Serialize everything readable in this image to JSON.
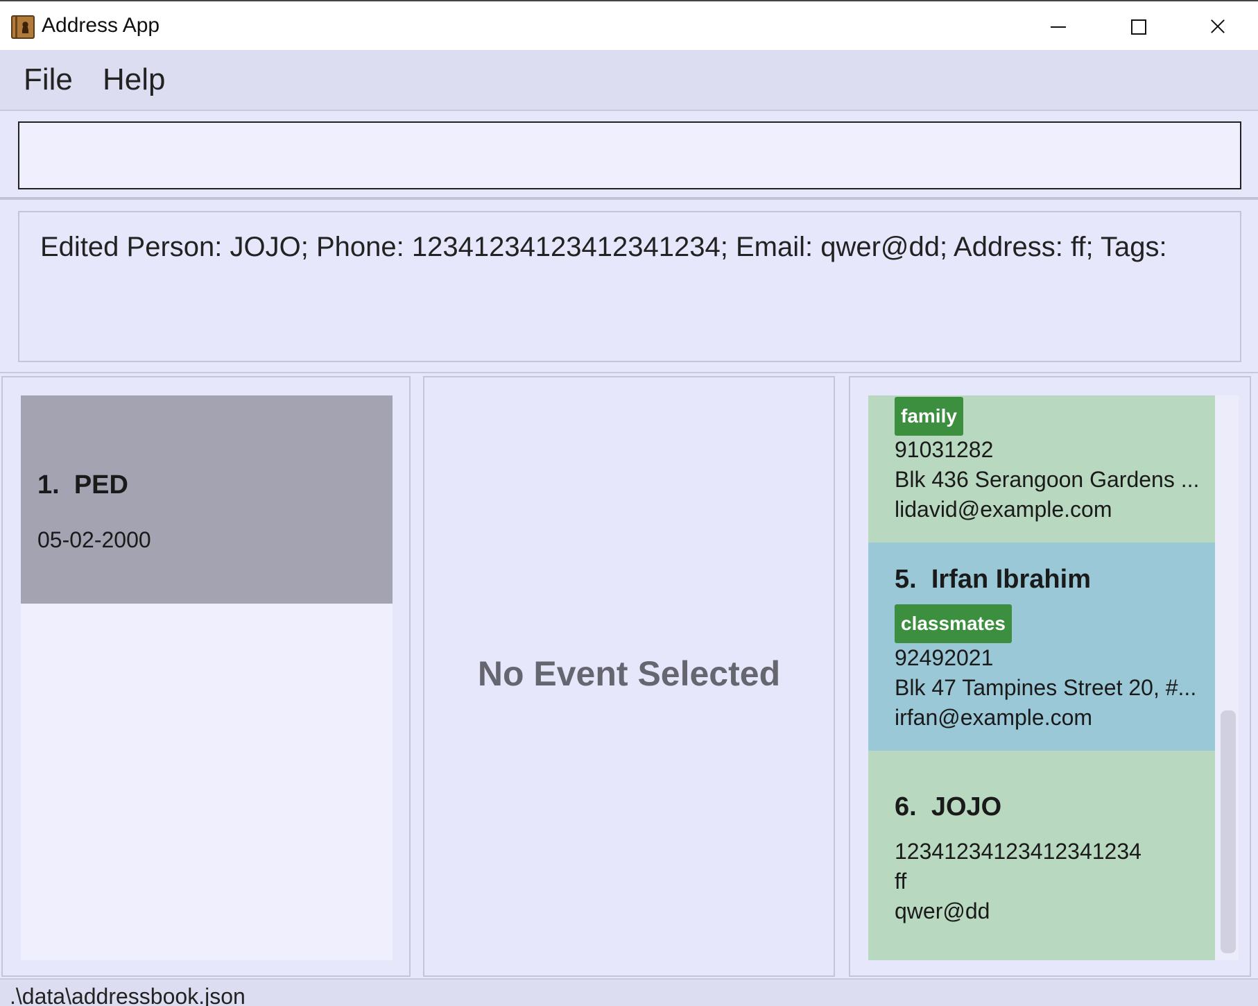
{
  "window": {
    "title": "Address App"
  },
  "menu": {
    "file": "File",
    "help": "Help"
  },
  "command": {
    "value": "",
    "placeholder": ""
  },
  "result": {
    "text": "Edited Person: JOJO; Phone: 12341234123412341234; Email: qwer@dd; Address: ff; Tags:"
  },
  "events": [
    {
      "index": "1.",
      "name": "PED",
      "date": "05-02-2000"
    }
  ],
  "event_detail": {
    "empty_text": "No Event Selected"
  },
  "persons": [
    {
      "tag": "family",
      "phone": "91031282",
      "address": "Blk 436 Serangoon Gardens ...",
      "email": "lidavid@example.com"
    },
    {
      "index": "5.",
      "name": "Irfan Ibrahim",
      "tag": "classmates",
      "phone": "92492021",
      "address": "Blk 47 Tampines Street 20, #...",
      "email": "irfan@example.com"
    },
    {
      "index": "6.",
      "name": "JOJO",
      "phone": "12341234123412341234",
      "address": "ff",
      "email": "qwer@dd"
    }
  ],
  "status": {
    "path": ".\\data\\addressbook.json"
  },
  "colors": {
    "selected_card": "#a3a3b1",
    "person_green": "#b9d8c0",
    "person_blue": "#9bc8d7",
    "tag": "#3c8f3e"
  }
}
